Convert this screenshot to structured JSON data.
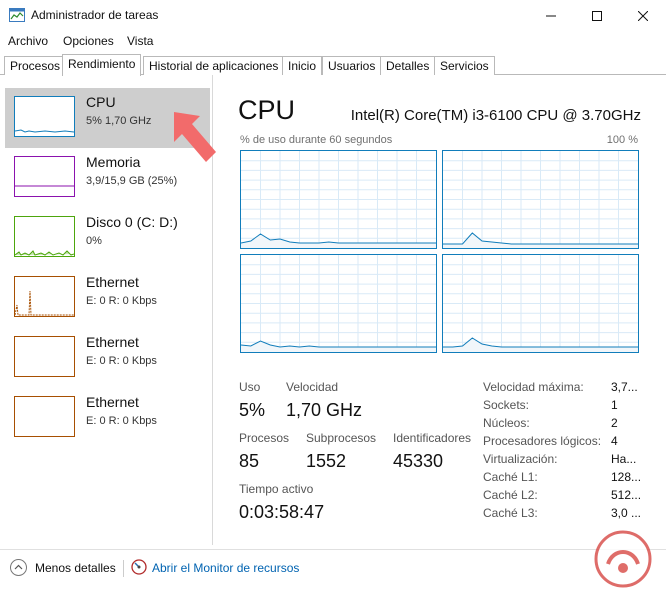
{
  "window": {
    "title": "Administrador de tareas"
  },
  "menu": [
    "Archivo",
    "Opciones",
    "Vista"
  ],
  "tabs": [
    "Procesos",
    "Rendimiento",
    "Historial de aplicaciones",
    "Inicio",
    "Usuarios",
    "Detalles",
    "Servicios"
  ],
  "active_tab": "Rendimiento",
  "sidebar": [
    {
      "name": "CPU",
      "sub": "5% 1,70 GHz",
      "color": "#117dbb"
    },
    {
      "name": "Memoria",
      "sub": "3,9/15,9 GB (25%)",
      "color": "#8b12ae"
    },
    {
      "name": "Disco 0 (C: D:)",
      "sub": "0%",
      "color": "#4da60c"
    },
    {
      "name": "Ethernet",
      "sub": "E: 0 R: 0 Kbps",
      "color": "#a74f01"
    },
    {
      "name": "Ethernet",
      "sub": "E: 0 R: 0 Kbps",
      "color": "#a74f01"
    },
    {
      "name": "Ethernet",
      "sub": "E: 0 R: 0 Kbps",
      "color": "#a74f01"
    }
  ],
  "main": {
    "title": "CPU",
    "model": "Intel(R) Core(TM) i3-6100 CPU @ 3.70GHz",
    "graph_label": "% de uso durante 60 segundos",
    "graph_max": "100 %"
  },
  "stats": {
    "uso_label": "Uso",
    "uso_value": "5%",
    "velocidad_label": "Velocidad",
    "velocidad_value": "1,70 GHz",
    "procesos_label": "Procesos",
    "procesos_value": "85",
    "subprocesos_label": "Subprocesos",
    "subprocesos_value": "1552",
    "identificadores_label": "Identificadores",
    "identificadores_value": "45330",
    "tiempo_label": "Tiempo activo",
    "tiempo_value": "0:03:58:47"
  },
  "specs": [
    {
      "label": "Velocidad máxima:",
      "value": "3,7..."
    },
    {
      "label": "Sockets:",
      "value": "1"
    },
    {
      "label": "Núcleos:",
      "value": "2"
    },
    {
      "label": "Procesadores lógicos:",
      "value": "4"
    },
    {
      "label": "Virtualización:",
      "value": "Ha..."
    },
    {
      "label": "Caché L1:",
      "value": "128..."
    },
    {
      "label": "Caché L2:",
      "value": "512..."
    },
    {
      "label": "Caché L3:",
      "value": "3,0 ..."
    }
  ],
  "footer": {
    "less_details": "Menos detalles",
    "monitor_link": "Abrir el Monitor de recursos"
  },
  "colors": {
    "cpu": "#117dbb",
    "arrow": "#f26b6b"
  }
}
